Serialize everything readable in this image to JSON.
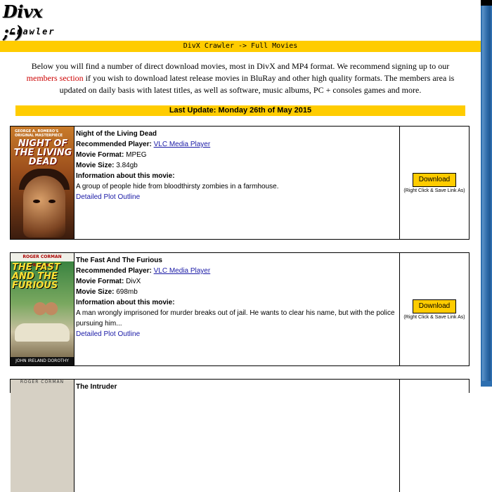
{
  "logo": {
    "brand": "Divx ;-)",
    "sub": "Crawler"
  },
  "topbar": {
    "text": "DivX Crawler -> Full Movies"
  },
  "intro": {
    "text_before": "Below you will find a number of direct download movies, most in DivX and MP4 format. We recommend signing up to our ",
    "link": "members section",
    "text_after": " if you wish to download latest release movies in BluRay and other high quality formats. The members area is updated on daily basis with latest titles, as well as software, music albums, PC + consoles games and more."
  },
  "update": {
    "text": "Last Update: Monday 26th of May 2015"
  },
  "labels": {
    "player": "Recommended Player:",
    "format": "Movie Format:",
    "size": "Movie Size:",
    "info": "Information about this movie:",
    "plot": "Detailed Plot Outline",
    "download": "Download",
    "hint": "(Right Click & Save Link As)"
  },
  "movies": [
    {
      "title": "Night of the Living Dead",
      "player": "VLC Media Player",
      "format": "MPEG",
      "size": "3.84gb",
      "description": "A group of people hide from bloodthirsty zombies in a farmhouse.",
      "poster": {
        "top": "GEORGE A. ROMERO'S ORIGINAL MASTERPIECE",
        "title": "NIGHT OF THE LIVING DEAD"
      }
    },
    {
      "title": "The Fast And The Furious",
      "player": "VLC Media Player",
      "format": "DivX",
      "size": "698mb",
      "description": "A man wrongly imprisoned for murder breaks out of jail. He wants to clear his name, but with the police pursuing him...",
      "poster": {
        "top": "ROGER CORMAN PRESENTS",
        "title": "THE FAST AND THE FURIOUS",
        "bottom": "JOHN IRELAND  DOROTHY MALONE"
      }
    },
    {
      "title": "The Intruder",
      "poster": {
        "top": "ROGER CORMAN"
      }
    }
  ]
}
